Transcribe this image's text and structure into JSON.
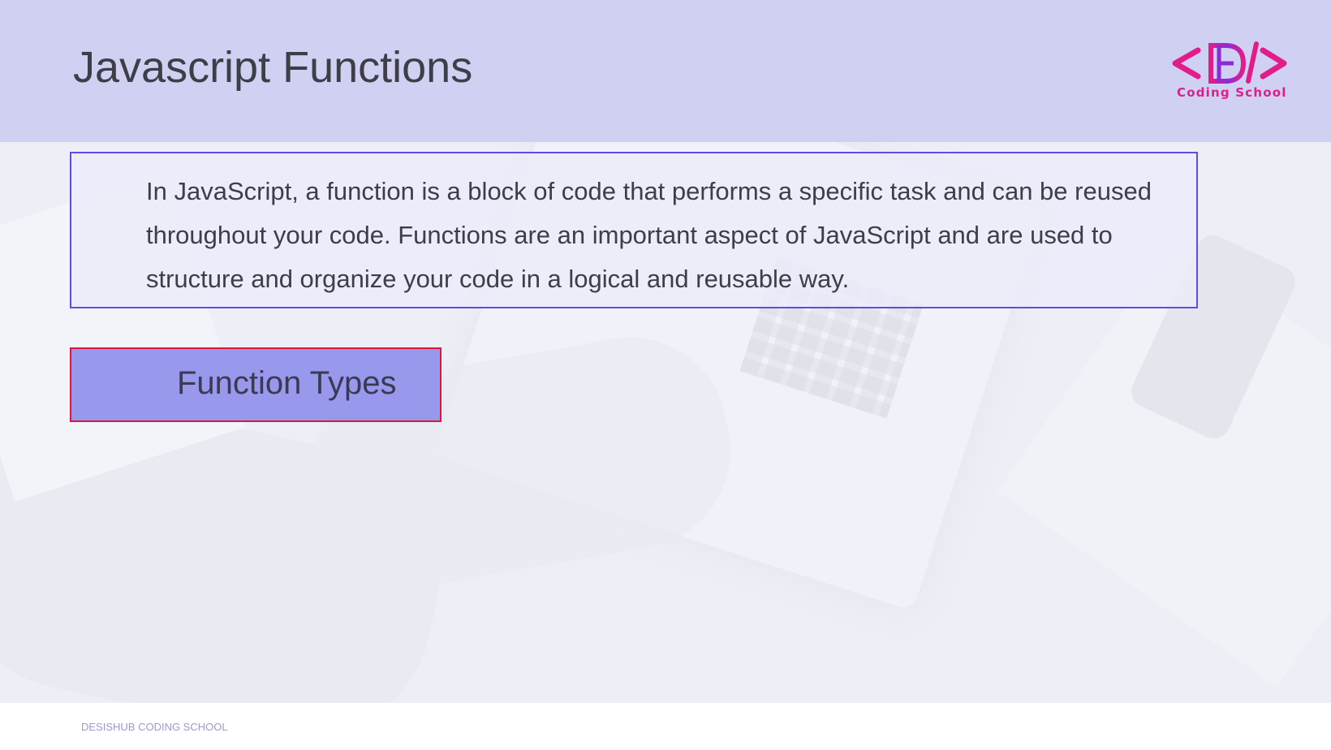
{
  "slide": {
    "title": "Javascript Functions"
  },
  "logo": {
    "mark": "<D/>",
    "text": "Coding School",
    "color": "#e21d8a"
  },
  "intro": {
    "text": "In JavaScript, a function is a block of code that performs a specific task and can be reused throughout your code. Functions are an important aspect of JavaScript and are used to structure and organize your code in a logical and reusable way."
  },
  "section": {
    "label": "Function Types"
  },
  "footer": {
    "text": "DESISHUB CODING SCHOOL"
  },
  "colors": {
    "header_band": "#d0d0f3",
    "intro_border": "#5a4fe0",
    "section_fill": "#9898ed",
    "section_border": "#e0153a",
    "footer_text": "#9a9ad6"
  }
}
